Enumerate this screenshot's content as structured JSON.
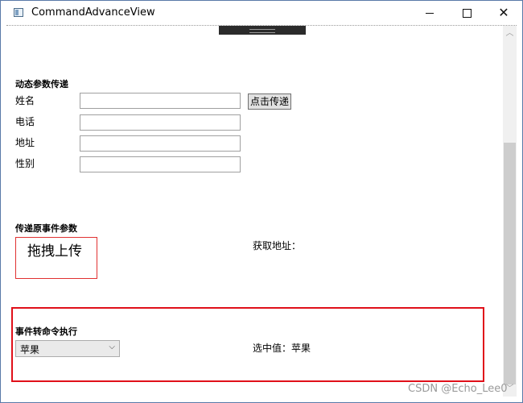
{
  "window": {
    "title": "CommandAdvanceView",
    "minimize_icon": "minimize-icon",
    "maximize_icon": "maximize-icon",
    "close_icon": "close-icon"
  },
  "section_dynamic": {
    "title": "动态参数传递",
    "fields": [
      {
        "label": "姓名",
        "value": ""
      },
      {
        "label": "电话",
        "value": ""
      },
      {
        "label": "地址",
        "value": ""
      },
      {
        "label": "性别",
        "value": ""
      }
    ],
    "submit_label": "点击传递"
  },
  "section_event_args": {
    "title": "传递原事件参数",
    "drop_label": "拖拽上传",
    "result_label": "获取地址："
  },
  "section_event_command": {
    "title": "事件转命令执行",
    "combo_value": "苹果",
    "selected_label": "选中值：苹果"
  },
  "watermark": "CSDN @Echo_Lee0",
  "colors": {
    "highlight": "#e0101a",
    "scroll_thumb": "#cdcdcd"
  }
}
